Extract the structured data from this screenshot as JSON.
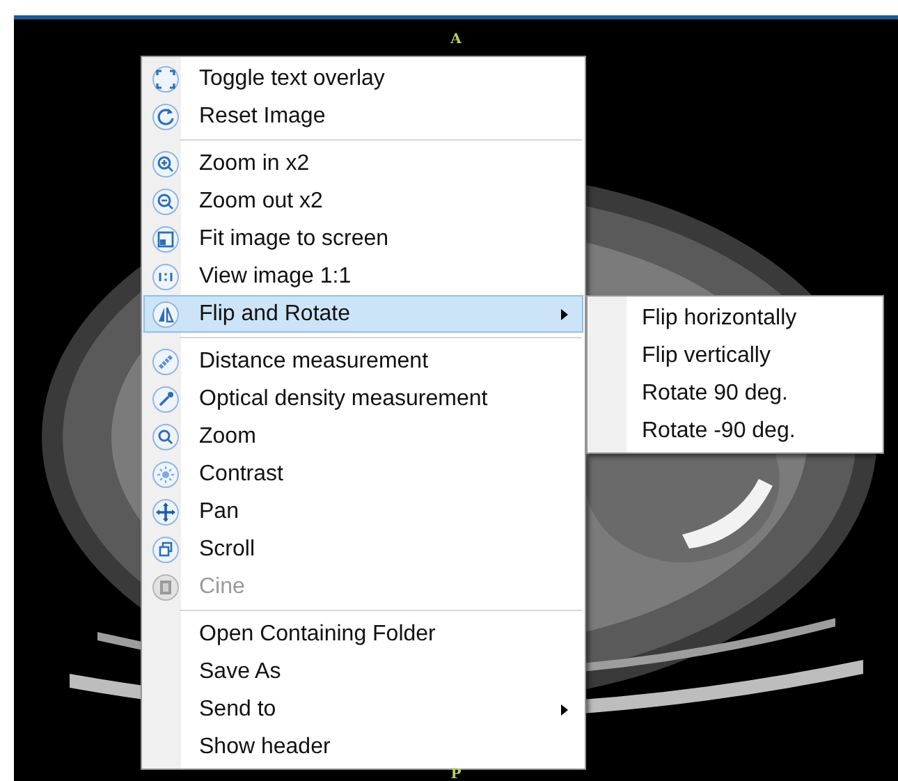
{
  "viewer": {
    "top_marker": "A",
    "bottom_marker": "P"
  },
  "menu": {
    "groups": [
      [
        {
          "label": "Toggle text overlay",
          "selected": false,
          "disabled": false,
          "has_submenu": false
        },
        {
          "label": "Reset Image",
          "selected": false,
          "disabled": false,
          "has_submenu": false
        }
      ],
      [
        {
          "label": "Zoom in x2",
          "selected": false,
          "disabled": false,
          "has_submenu": false
        },
        {
          "label": "Zoom out x2",
          "selected": false,
          "disabled": false,
          "has_submenu": false
        },
        {
          "label": "Fit image to screen",
          "selected": false,
          "disabled": false,
          "has_submenu": false
        },
        {
          "label": "View image 1:1",
          "selected": false,
          "disabled": false,
          "has_submenu": false
        },
        {
          "label": "Flip and Rotate",
          "selected": true,
          "disabled": false,
          "has_submenu": true
        }
      ],
      [
        {
          "label": "Distance measurement",
          "selected": false,
          "disabled": false,
          "has_submenu": false
        },
        {
          "label": "Optical density measurement",
          "selected": false,
          "disabled": false,
          "has_submenu": false
        },
        {
          "label": "Zoom",
          "selected": false,
          "disabled": false,
          "has_submenu": false
        },
        {
          "label": "Contrast",
          "selected": false,
          "disabled": false,
          "has_submenu": false
        },
        {
          "label": "Pan",
          "selected": false,
          "disabled": false,
          "has_submenu": false
        },
        {
          "label": "Scroll",
          "selected": false,
          "disabled": false,
          "has_submenu": false
        },
        {
          "label": "Cine",
          "selected": false,
          "disabled": true,
          "has_submenu": false
        }
      ],
      [
        {
          "label": "Open Containing Folder",
          "selected": false,
          "disabled": false,
          "has_submenu": false
        },
        {
          "label": "Save As",
          "selected": false,
          "disabled": false,
          "has_submenu": false
        },
        {
          "label": "Send to",
          "selected": false,
          "disabled": false,
          "has_submenu": true
        },
        {
          "label": "Show header",
          "selected": false,
          "disabled": false,
          "has_submenu": false
        }
      ]
    ]
  },
  "submenu": {
    "items": [
      {
        "label": "Flip horizontally"
      },
      {
        "label": "Flip vertically"
      },
      {
        "label": "Rotate 90 deg."
      },
      {
        "label": "Rotate -90 deg."
      }
    ]
  }
}
